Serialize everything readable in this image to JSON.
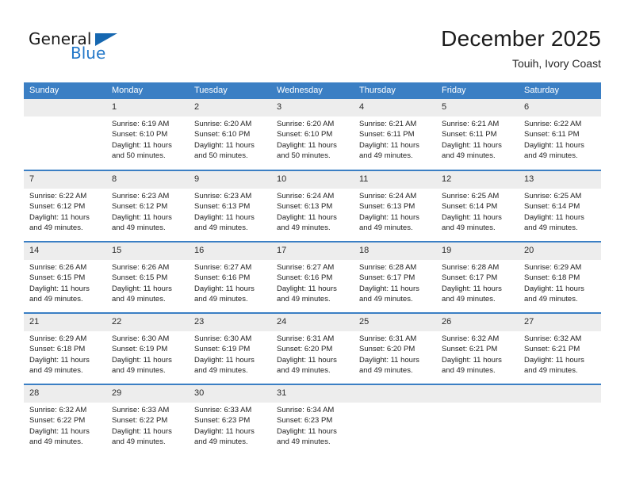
{
  "brand": {
    "name_part1": "General",
    "name_part2": "Blue",
    "triangle_icon": "brand-triangle-icon",
    "accent_color": "#1667b0",
    "blue_text_color": "#2277c8"
  },
  "header": {
    "month_title": "December 2025",
    "location": "Touih, Ivory Coast"
  },
  "calendar": {
    "header_bg": "#3b7fc4",
    "daynum_bg": "#ededed",
    "weekdays": [
      "Sunday",
      "Monday",
      "Tuesday",
      "Wednesday",
      "Thursday",
      "Friday",
      "Saturday"
    ],
    "weeks": [
      [
        {
          "day": "",
          "sunrise": "",
          "sunset": "",
          "daylight_1": "",
          "daylight_2": ""
        },
        {
          "day": "1",
          "sunrise": "Sunrise: 6:19 AM",
          "sunset": "Sunset: 6:10 PM",
          "daylight_1": "Daylight: 11 hours",
          "daylight_2": "and 50 minutes."
        },
        {
          "day": "2",
          "sunrise": "Sunrise: 6:20 AM",
          "sunset": "Sunset: 6:10 PM",
          "daylight_1": "Daylight: 11 hours",
          "daylight_2": "and 50 minutes."
        },
        {
          "day": "3",
          "sunrise": "Sunrise: 6:20 AM",
          "sunset": "Sunset: 6:10 PM",
          "daylight_1": "Daylight: 11 hours",
          "daylight_2": "and 50 minutes."
        },
        {
          "day": "4",
          "sunrise": "Sunrise: 6:21 AM",
          "sunset": "Sunset: 6:11 PM",
          "daylight_1": "Daylight: 11 hours",
          "daylight_2": "and 49 minutes."
        },
        {
          "day": "5",
          "sunrise": "Sunrise: 6:21 AM",
          "sunset": "Sunset: 6:11 PM",
          "daylight_1": "Daylight: 11 hours",
          "daylight_2": "and 49 minutes."
        },
        {
          "day": "6",
          "sunrise": "Sunrise: 6:22 AM",
          "sunset": "Sunset: 6:11 PM",
          "daylight_1": "Daylight: 11 hours",
          "daylight_2": "and 49 minutes."
        }
      ],
      [
        {
          "day": "7",
          "sunrise": "Sunrise: 6:22 AM",
          "sunset": "Sunset: 6:12 PM",
          "daylight_1": "Daylight: 11 hours",
          "daylight_2": "and 49 minutes."
        },
        {
          "day": "8",
          "sunrise": "Sunrise: 6:23 AM",
          "sunset": "Sunset: 6:12 PM",
          "daylight_1": "Daylight: 11 hours",
          "daylight_2": "and 49 minutes."
        },
        {
          "day": "9",
          "sunrise": "Sunrise: 6:23 AM",
          "sunset": "Sunset: 6:13 PM",
          "daylight_1": "Daylight: 11 hours",
          "daylight_2": "and 49 minutes."
        },
        {
          "day": "10",
          "sunrise": "Sunrise: 6:24 AM",
          "sunset": "Sunset: 6:13 PM",
          "daylight_1": "Daylight: 11 hours",
          "daylight_2": "and 49 minutes."
        },
        {
          "day": "11",
          "sunrise": "Sunrise: 6:24 AM",
          "sunset": "Sunset: 6:13 PM",
          "daylight_1": "Daylight: 11 hours",
          "daylight_2": "and 49 minutes."
        },
        {
          "day": "12",
          "sunrise": "Sunrise: 6:25 AM",
          "sunset": "Sunset: 6:14 PM",
          "daylight_1": "Daylight: 11 hours",
          "daylight_2": "and 49 minutes."
        },
        {
          "day": "13",
          "sunrise": "Sunrise: 6:25 AM",
          "sunset": "Sunset: 6:14 PM",
          "daylight_1": "Daylight: 11 hours",
          "daylight_2": "and 49 minutes."
        }
      ],
      [
        {
          "day": "14",
          "sunrise": "Sunrise: 6:26 AM",
          "sunset": "Sunset: 6:15 PM",
          "daylight_1": "Daylight: 11 hours",
          "daylight_2": "and 49 minutes."
        },
        {
          "day": "15",
          "sunrise": "Sunrise: 6:26 AM",
          "sunset": "Sunset: 6:15 PM",
          "daylight_1": "Daylight: 11 hours",
          "daylight_2": "and 49 minutes."
        },
        {
          "day": "16",
          "sunrise": "Sunrise: 6:27 AM",
          "sunset": "Sunset: 6:16 PM",
          "daylight_1": "Daylight: 11 hours",
          "daylight_2": "and 49 minutes."
        },
        {
          "day": "17",
          "sunrise": "Sunrise: 6:27 AM",
          "sunset": "Sunset: 6:16 PM",
          "daylight_1": "Daylight: 11 hours",
          "daylight_2": "and 49 minutes."
        },
        {
          "day": "18",
          "sunrise": "Sunrise: 6:28 AM",
          "sunset": "Sunset: 6:17 PM",
          "daylight_1": "Daylight: 11 hours",
          "daylight_2": "and 49 minutes."
        },
        {
          "day": "19",
          "sunrise": "Sunrise: 6:28 AM",
          "sunset": "Sunset: 6:17 PM",
          "daylight_1": "Daylight: 11 hours",
          "daylight_2": "and 49 minutes."
        },
        {
          "day": "20",
          "sunrise": "Sunrise: 6:29 AM",
          "sunset": "Sunset: 6:18 PM",
          "daylight_1": "Daylight: 11 hours",
          "daylight_2": "and 49 minutes."
        }
      ],
      [
        {
          "day": "21",
          "sunrise": "Sunrise: 6:29 AM",
          "sunset": "Sunset: 6:18 PM",
          "daylight_1": "Daylight: 11 hours",
          "daylight_2": "and 49 minutes."
        },
        {
          "day": "22",
          "sunrise": "Sunrise: 6:30 AM",
          "sunset": "Sunset: 6:19 PM",
          "daylight_1": "Daylight: 11 hours",
          "daylight_2": "and 49 minutes."
        },
        {
          "day": "23",
          "sunrise": "Sunrise: 6:30 AM",
          "sunset": "Sunset: 6:19 PM",
          "daylight_1": "Daylight: 11 hours",
          "daylight_2": "and 49 minutes."
        },
        {
          "day": "24",
          "sunrise": "Sunrise: 6:31 AM",
          "sunset": "Sunset: 6:20 PM",
          "daylight_1": "Daylight: 11 hours",
          "daylight_2": "and 49 minutes."
        },
        {
          "day": "25",
          "sunrise": "Sunrise: 6:31 AM",
          "sunset": "Sunset: 6:20 PM",
          "daylight_1": "Daylight: 11 hours",
          "daylight_2": "and 49 minutes."
        },
        {
          "day": "26",
          "sunrise": "Sunrise: 6:32 AM",
          "sunset": "Sunset: 6:21 PM",
          "daylight_1": "Daylight: 11 hours",
          "daylight_2": "and 49 minutes."
        },
        {
          "day": "27",
          "sunrise": "Sunrise: 6:32 AM",
          "sunset": "Sunset: 6:21 PM",
          "daylight_1": "Daylight: 11 hours",
          "daylight_2": "and 49 minutes."
        }
      ],
      [
        {
          "day": "28",
          "sunrise": "Sunrise: 6:32 AM",
          "sunset": "Sunset: 6:22 PM",
          "daylight_1": "Daylight: 11 hours",
          "daylight_2": "and 49 minutes."
        },
        {
          "day": "29",
          "sunrise": "Sunrise: 6:33 AM",
          "sunset": "Sunset: 6:22 PM",
          "daylight_1": "Daylight: 11 hours",
          "daylight_2": "and 49 minutes."
        },
        {
          "day": "30",
          "sunrise": "Sunrise: 6:33 AM",
          "sunset": "Sunset: 6:23 PM",
          "daylight_1": "Daylight: 11 hours",
          "daylight_2": "and 49 minutes."
        },
        {
          "day": "31",
          "sunrise": "Sunrise: 6:34 AM",
          "sunset": "Sunset: 6:23 PM",
          "daylight_1": "Daylight: 11 hours",
          "daylight_2": "and 49 minutes."
        },
        {
          "day": "",
          "sunrise": "",
          "sunset": "",
          "daylight_1": "",
          "daylight_2": ""
        },
        {
          "day": "",
          "sunrise": "",
          "sunset": "",
          "daylight_1": "",
          "daylight_2": ""
        },
        {
          "day": "",
          "sunrise": "",
          "sunset": "",
          "daylight_1": "",
          "daylight_2": ""
        }
      ]
    ]
  }
}
